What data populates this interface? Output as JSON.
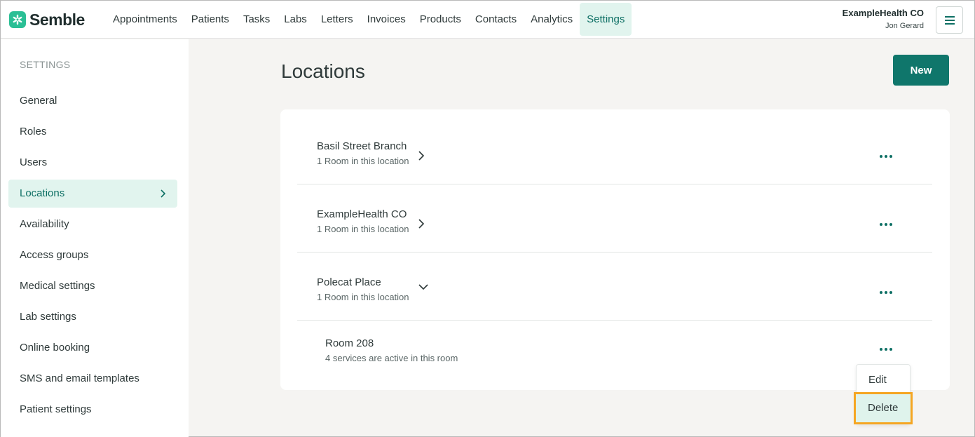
{
  "brand": {
    "name": "Semble",
    "accent": "#0f766b",
    "logo_color": "#2bbf95"
  },
  "nav": {
    "items": [
      {
        "label": "Appointments"
      },
      {
        "label": "Patients"
      },
      {
        "label": "Tasks"
      },
      {
        "label": "Labs"
      },
      {
        "label": "Letters"
      },
      {
        "label": "Invoices"
      },
      {
        "label": "Products"
      },
      {
        "label": "Contacts"
      },
      {
        "label": "Analytics"
      },
      {
        "label": "Settings"
      }
    ],
    "active": "Settings"
  },
  "account": {
    "organization": "ExampleHealth CO",
    "user": "Jon Gerard"
  },
  "menu_button_icon": "hamburger-icon",
  "sidebar": {
    "heading": "SETTINGS",
    "items": [
      {
        "label": "General"
      },
      {
        "label": "Roles"
      },
      {
        "label": "Users"
      },
      {
        "label": "Locations"
      },
      {
        "label": "Availability"
      },
      {
        "label": "Access groups"
      },
      {
        "label": "Medical settings"
      },
      {
        "label": "Lab settings"
      },
      {
        "label": "Online booking"
      },
      {
        "label": "SMS and email templates"
      },
      {
        "label": "Patient settings"
      }
    ],
    "active": "Locations"
  },
  "main": {
    "title": "Locations",
    "new_button": "New",
    "locations": [
      {
        "name": "Basil Street Branch",
        "subtitle": "1 Room in this location",
        "expanded": false
      },
      {
        "name": "ExampleHealth CO",
        "subtitle": "1 Room in this location",
        "expanded": false
      },
      {
        "name": "Polecat Place",
        "subtitle": "1 Room in this location",
        "expanded": true
      }
    ],
    "rooms": [
      {
        "name": "Room 208",
        "subtitle": "4 services are active in this room"
      }
    ]
  },
  "row_menu": {
    "items": [
      {
        "label": "Edit"
      },
      {
        "label": "Delete"
      }
    ],
    "highlighted": "Delete",
    "highlight_color": "#f5a623"
  }
}
